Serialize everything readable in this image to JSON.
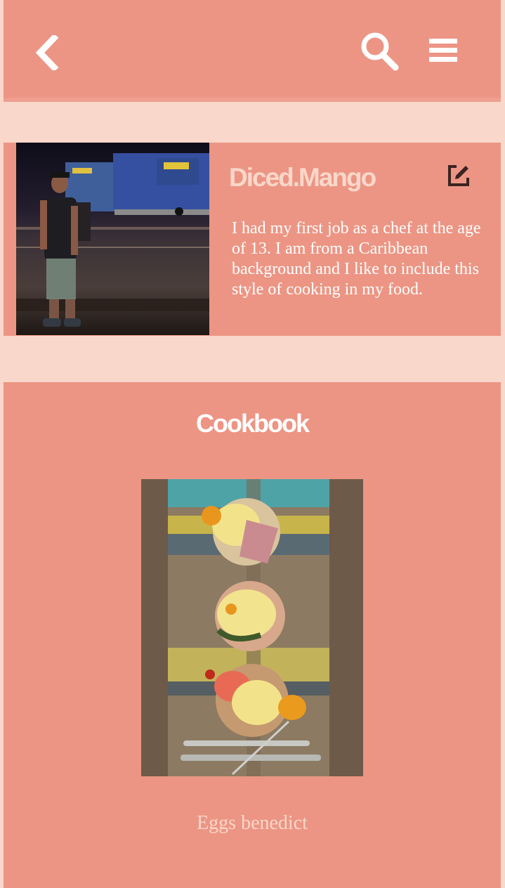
{
  "header": {
    "back_icon": "chevron-left-icon",
    "search_icon": "search-icon",
    "menu_icon": "hamburger-menu-icon"
  },
  "profile": {
    "username": "Diced.Mango",
    "edit_icon": "edit-icon",
    "bio": "I had my first job as a chef at the age of 13. I am from a Caribbean background and I like to include this style of cooking in my food."
  },
  "cookbook": {
    "title": "Cookbook",
    "recipes": [
      {
        "caption": "Eggs benedict"
      }
    ]
  },
  "colors": {
    "panel": "#ec9584",
    "background": "#f9d7ca",
    "text_light": "#ffffff",
    "text_accent": "#f9d7ca"
  }
}
